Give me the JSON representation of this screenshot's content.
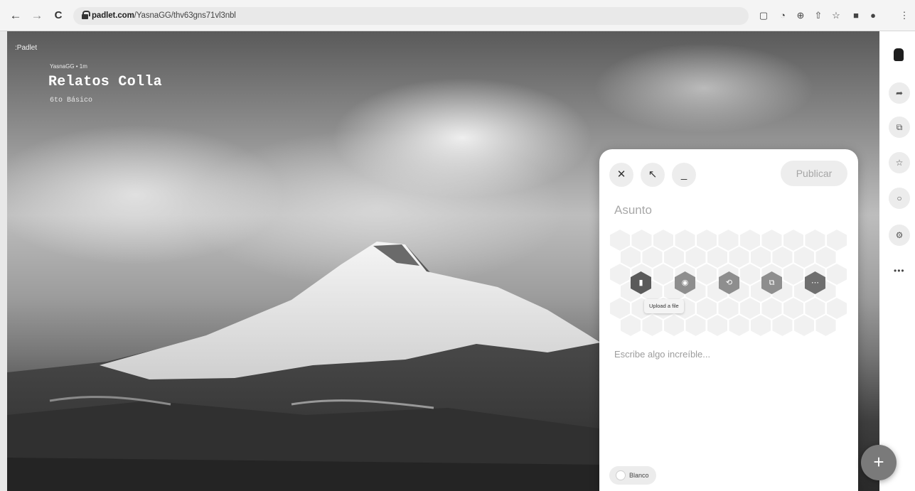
{
  "browser": {
    "back_icon": "arrow-left-icon",
    "forward_icon": "arrow-right-icon",
    "reload_icon": "reload-icon",
    "url_host": "padlet.com",
    "url_path": "/YasnaGG/thv63gns71vl3nbl"
  },
  "board": {
    "brand": ":Padlet",
    "author": "YasnaGG • 1m",
    "title": "Relatos Colla",
    "subtitle": "6to Básico"
  },
  "composer": {
    "publish_label": "Publicar",
    "subject_placeholder": "Asunto",
    "attachments": [
      {
        "name": "upload-file-icon",
        "color": "#5a5a5a"
      },
      {
        "name": "camera-icon",
        "color": "#8e8e8e"
      },
      {
        "name": "link-icon",
        "color": "#8e8e8e"
      },
      {
        "name": "image-search-icon",
        "color": "#8e8e8e"
      },
      {
        "name": "more-icon",
        "color": "#6f6f6f"
      }
    ],
    "tooltip": "Upload a file",
    "body_placeholder": "Escribe algo increíble...",
    "color_label": "Blanco"
  },
  "fab_label": "+"
}
